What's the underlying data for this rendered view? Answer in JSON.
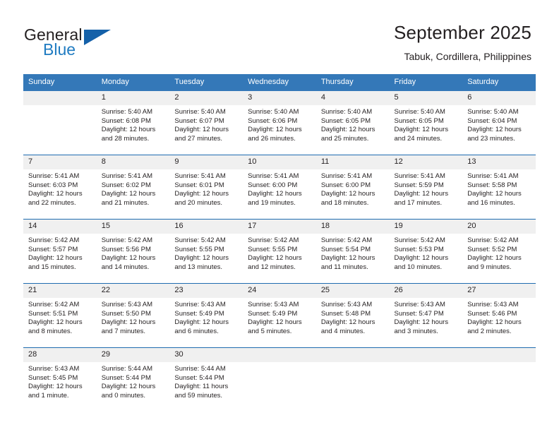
{
  "brand": {
    "name_top": "General",
    "name_bottom": "Blue",
    "accent_color": "#1561a9",
    "blue_text_color": "#1f7bc1"
  },
  "header": {
    "title": "September 2025",
    "subtitle": "Tabuk, Cordillera, Philippines"
  },
  "calendar": {
    "header_bg": "#3478b8",
    "daynum_bg": "#f0f0f0",
    "separator_color": "#1f6cb0",
    "weekday_headers": [
      "Sunday",
      "Monday",
      "Tuesday",
      "Wednesday",
      "Thursday",
      "Friday",
      "Saturday"
    ],
    "weeks": [
      [
        {
          "day": "",
          "sunrise": "",
          "sunset": "",
          "daylight1": "",
          "daylight2": "",
          "empty": true
        },
        {
          "day": "1",
          "sunrise": "Sunrise: 5:40 AM",
          "sunset": "Sunset: 6:08 PM",
          "daylight1": "Daylight: 12 hours",
          "daylight2": "and 28 minutes."
        },
        {
          "day": "2",
          "sunrise": "Sunrise: 5:40 AM",
          "sunset": "Sunset: 6:07 PM",
          "daylight1": "Daylight: 12 hours",
          "daylight2": "and 27 minutes."
        },
        {
          "day": "3",
          "sunrise": "Sunrise: 5:40 AM",
          "sunset": "Sunset: 6:06 PM",
          "daylight1": "Daylight: 12 hours",
          "daylight2": "and 26 minutes."
        },
        {
          "day": "4",
          "sunrise": "Sunrise: 5:40 AM",
          "sunset": "Sunset: 6:05 PM",
          "daylight1": "Daylight: 12 hours",
          "daylight2": "and 25 minutes."
        },
        {
          "day": "5",
          "sunrise": "Sunrise: 5:40 AM",
          "sunset": "Sunset: 6:05 PM",
          "daylight1": "Daylight: 12 hours",
          "daylight2": "and 24 minutes."
        },
        {
          "day": "6",
          "sunrise": "Sunrise: 5:40 AM",
          "sunset": "Sunset: 6:04 PM",
          "daylight1": "Daylight: 12 hours",
          "daylight2": "and 23 minutes."
        }
      ],
      [
        {
          "day": "7",
          "sunrise": "Sunrise: 5:41 AM",
          "sunset": "Sunset: 6:03 PM",
          "daylight1": "Daylight: 12 hours",
          "daylight2": "and 22 minutes."
        },
        {
          "day": "8",
          "sunrise": "Sunrise: 5:41 AM",
          "sunset": "Sunset: 6:02 PM",
          "daylight1": "Daylight: 12 hours",
          "daylight2": "and 21 minutes."
        },
        {
          "day": "9",
          "sunrise": "Sunrise: 5:41 AM",
          "sunset": "Sunset: 6:01 PM",
          "daylight1": "Daylight: 12 hours",
          "daylight2": "and 20 minutes."
        },
        {
          "day": "10",
          "sunrise": "Sunrise: 5:41 AM",
          "sunset": "Sunset: 6:00 PM",
          "daylight1": "Daylight: 12 hours",
          "daylight2": "and 19 minutes."
        },
        {
          "day": "11",
          "sunrise": "Sunrise: 5:41 AM",
          "sunset": "Sunset: 6:00 PM",
          "daylight1": "Daylight: 12 hours",
          "daylight2": "and 18 minutes."
        },
        {
          "day": "12",
          "sunrise": "Sunrise: 5:41 AM",
          "sunset": "Sunset: 5:59 PM",
          "daylight1": "Daylight: 12 hours",
          "daylight2": "and 17 minutes."
        },
        {
          "day": "13",
          "sunrise": "Sunrise: 5:41 AM",
          "sunset": "Sunset: 5:58 PM",
          "daylight1": "Daylight: 12 hours",
          "daylight2": "and 16 minutes."
        }
      ],
      [
        {
          "day": "14",
          "sunrise": "Sunrise: 5:42 AM",
          "sunset": "Sunset: 5:57 PM",
          "daylight1": "Daylight: 12 hours",
          "daylight2": "and 15 minutes."
        },
        {
          "day": "15",
          "sunrise": "Sunrise: 5:42 AM",
          "sunset": "Sunset: 5:56 PM",
          "daylight1": "Daylight: 12 hours",
          "daylight2": "and 14 minutes."
        },
        {
          "day": "16",
          "sunrise": "Sunrise: 5:42 AM",
          "sunset": "Sunset: 5:55 PM",
          "daylight1": "Daylight: 12 hours",
          "daylight2": "and 13 minutes."
        },
        {
          "day": "17",
          "sunrise": "Sunrise: 5:42 AM",
          "sunset": "Sunset: 5:55 PM",
          "daylight1": "Daylight: 12 hours",
          "daylight2": "and 12 minutes."
        },
        {
          "day": "18",
          "sunrise": "Sunrise: 5:42 AM",
          "sunset": "Sunset: 5:54 PM",
          "daylight1": "Daylight: 12 hours",
          "daylight2": "and 11 minutes."
        },
        {
          "day": "19",
          "sunrise": "Sunrise: 5:42 AM",
          "sunset": "Sunset: 5:53 PM",
          "daylight1": "Daylight: 12 hours",
          "daylight2": "and 10 minutes."
        },
        {
          "day": "20",
          "sunrise": "Sunrise: 5:42 AM",
          "sunset": "Sunset: 5:52 PM",
          "daylight1": "Daylight: 12 hours",
          "daylight2": "and 9 minutes."
        }
      ],
      [
        {
          "day": "21",
          "sunrise": "Sunrise: 5:42 AM",
          "sunset": "Sunset: 5:51 PM",
          "daylight1": "Daylight: 12 hours",
          "daylight2": "and 8 minutes."
        },
        {
          "day": "22",
          "sunrise": "Sunrise: 5:43 AM",
          "sunset": "Sunset: 5:50 PM",
          "daylight1": "Daylight: 12 hours",
          "daylight2": "and 7 minutes."
        },
        {
          "day": "23",
          "sunrise": "Sunrise: 5:43 AM",
          "sunset": "Sunset: 5:49 PM",
          "daylight1": "Daylight: 12 hours",
          "daylight2": "and 6 minutes."
        },
        {
          "day": "24",
          "sunrise": "Sunrise: 5:43 AM",
          "sunset": "Sunset: 5:49 PM",
          "daylight1": "Daylight: 12 hours",
          "daylight2": "and 5 minutes."
        },
        {
          "day": "25",
          "sunrise": "Sunrise: 5:43 AM",
          "sunset": "Sunset: 5:48 PM",
          "daylight1": "Daylight: 12 hours",
          "daylight2": "and 4 minutes."
        },
        {
          "day": "26",
          "sunrise": "Sunrise: 5:43 AM",
          "sunset": "Sunset: 5:47 PM",
          "daylight1": "Daylight: 12 hours",
          "daylight2": "and 3 minutes."
        },
        {
          "day": "27",
          "sunrise": "Sunrise: 5:43 AM",
          "sunset": "Sunset: 5:46 PM",
          "daylight1": "Daylight: 12 hours",
          "daylight2": "and 2 minutes."
        }
      ],
      [
        {
          "day": "28",
          "sunrise": "Sunrise: 5:43 AM",
          "sunset": "Sunset: 5:45 PM",
          "daylight1": "Daylight: 12 hours",
          "daylight2": "and 1 minute."
        },
        {
          "day": "29",
          "sunrise": "Sunrise: 5:44 AM",
          "sunset": "Sunset: 5:44 PM",
          "daylight1": "Daylight: 12 hours",
          "daylight2": "and 0 minutes."
        },
        {
          "day": "30",
          "sunrise": "Sunrise: 5:44 AM",
          "sunset": "Sunset: 5:44 PM",
          "daylight1": "Daylight: 11 hours",
          "daylight2": "and 59 minutes."
        },
        {
          "day": "",
          "sunrise": "",
          "sunset": "",
          "daylight1": "",
          "daylight2": "",
          "empty": true
        },
        {
          "day": "",
          "sunrise": "",
          "sunset": "",
          "daylight1": "",
          "daylight2": "",
          "empty": true
        },
        {
          "day": "",
          "sunrise": "",
          "sunset": "",
          "daylight1": "",
          "daylight2": "",
          "empty": true
        },
        {
          "day": "",
          "sunrise": "",
          "sunset": "",
          "daylight1": "",
          "daylight2": "",
          "empty": true
        }
      ]
    ]
  }
}
